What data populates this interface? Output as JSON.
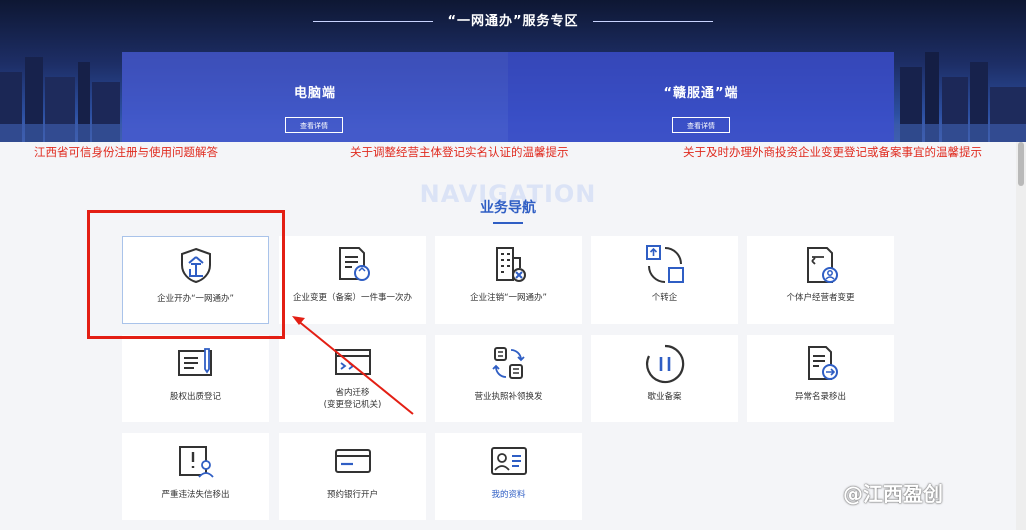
{
  "banner": {
    "title": "“一网通办”服务专区",
    "left_panel": {
      "title": "电脑端",
      "button": "查看详情"
    },
    "right_panel": {
      "title": "“赣服通”端",
      "button": "查看详情"
    }
  },
  "notices": [
    "江西省可信身份注册与使用问题解答",
    "关于调整经营主体登记实名认证的温馨提示",
    "关于及时办理外商投资企业变更登记或备案事宜的温馨提示"
  ],
  "navigation": {
    "background_text": "NAVIGATION",
    "title": "业务导航"
  },
  "tiles": [
    {
      "label": "企业开办“一网通办”",
      "icon": "enterprise-shield-icon"
    },
    {
      "label": "企业变更（备案）一件事一次办",
      "icon": "document-refresh-icon"
    },
    {
      "label": "企业注销“一网通办”",
      "icon": "building-cancel-icon"
    },
    {
      "label": "个转企",
      "icon": "individual-to-enterprise-icon"
    },
    {
      "label": "个体户经营者变更",
      "icon": "operator-change-icon"
    },
    {
      "label": "股权出质登记",
      "icon": "equity-pledge-icon"
    },
    {
      "label_line1": "省内迁移",
      "label_line2": "(变更登记机关)",
      "icon": "migration-icon"
    },
    {
      "label": "营业执照补领换发",
      "icon": "license-reissue-icon"
    },
    {
      "label": "歇业备案",
      "icon": "pause-icon"
    },
    {
      "label": "异常名录移出",
      "icon": "abnormal-list-removal-icon"
    },
    {
      "label": "严重违法失信移出",
      "icon": "serious-violation-icon"
    },
    {
      "label": "预约银行开户",
      "icon": "bank-card-icon"
    },
    {
      "label": "我的资料",
      "icon": "profile-card-icon"
    }
  ],
  "watermark": "@江西盈创",
  "colors": {
    "accent": "#2f5ec4",
    "notice_red": "#e02b1f",
    "annotation_red": "#e31f14",
    "panel_blue": "#4a5ad2"
  }
}
